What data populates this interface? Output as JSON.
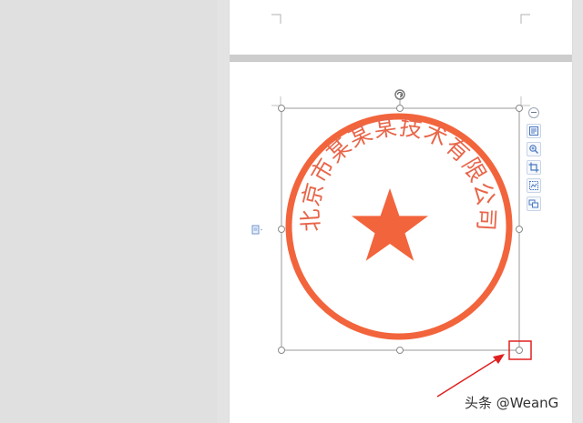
{
  "colors": {
    "background": "#e3e3e3",
    "page": "#ffffff",
    "page_separator": "#cdcdcd",
    "stamp_red": "#f2643c",
    "stamp_text": "#e8664a",
    "selection_frame": "#9a9a9a",
    "highlight_red": "#e02020",
    "arrow_red": "#e02020",
    "toolbar_icon": "#4a78c2"
  },
  "stamp": {
    "company_name": "北京市某某某技术有限公司",
    "center_symbol": "star-icon"
  },
  "selection": {
    "handles": [
      "top-left",
      "top",
      "top-right",
      "left",
      "right",
      "bottom-left",
      "bottom",
      "bottom-right"
    ],
    "rotate_handle": "rotate-icon",
    "highlighted_handle": "bottom-right"
  },
  "float_toolbar": {
    "items": [
      {
        "name": "collapse-icon"
      },
      {
        "name": "layout-options-icon"
      },
      {
        "name": "zoom-icon"
      },
      {
        "name": "crop-icon"
      },
      {
        "name": "color-adjust-icon"
      },
      {
        "name": "wrap-text-icon"
      }
    ]
  },
  "watermark": {
    "text": "头条 @WeanG"
  }
}
